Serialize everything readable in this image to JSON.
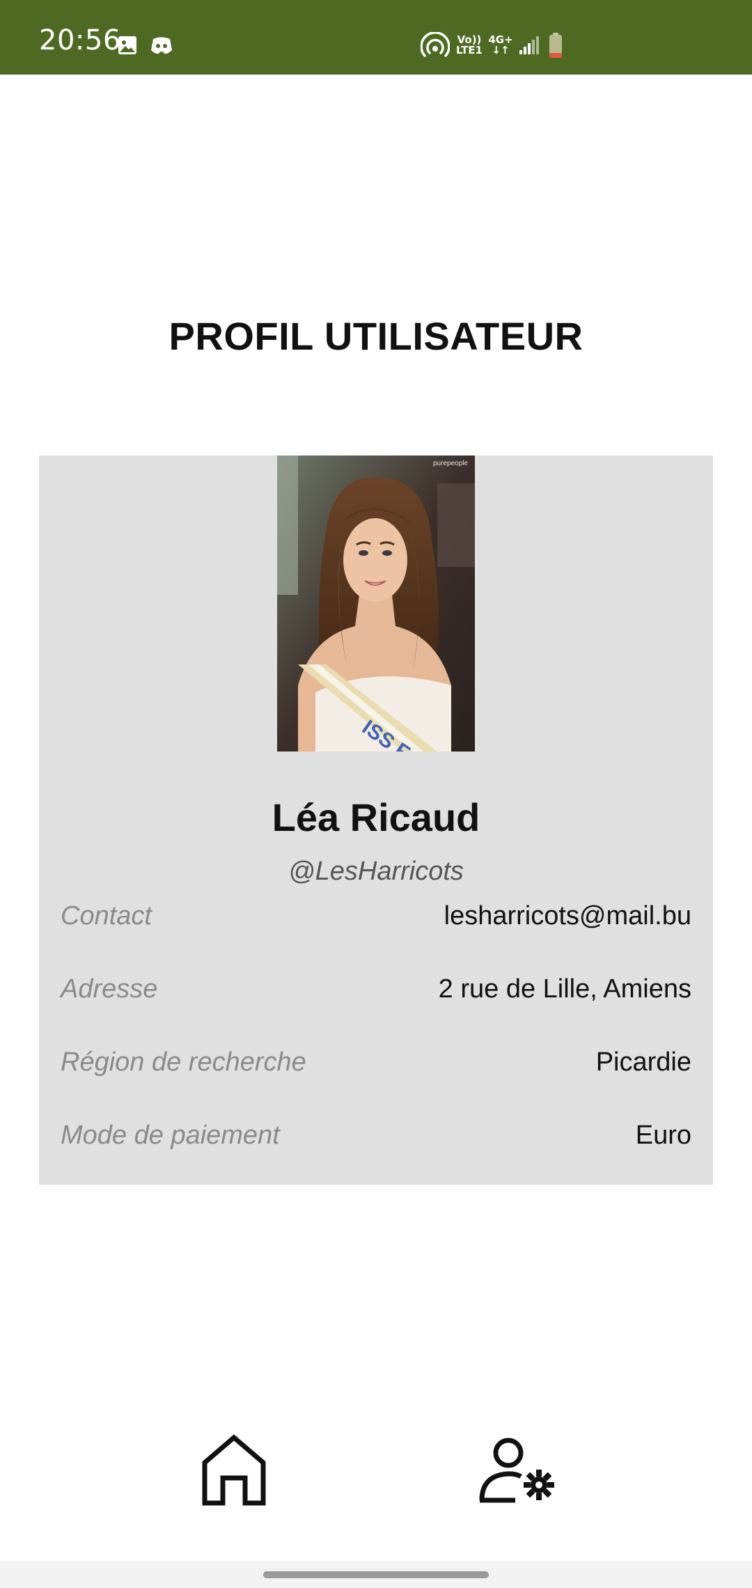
{
  "status_bar": {
    "time": "20:56",
    "background_color": "#4e6a22",
    "icons": [
      "gallery-icon",
      "discord-icon",
      "hotspot-icon",
      "volte-icon",
      "mobile-data-icon",
      "signal-icon",
      "battery-icon"
    ],
    "volte_label_top": "Vo))",
    "volte_label_bottom": "LTE1",
    "network_label": "4G+",
    "battery_level": 0.15
  },
  "page": {
    "title": "PROFIL UTILISATEUR"
  },
  "profile": {
    "name": "Léa Ricaud",
    "handle": "@LesHarricots",
    "photo_watermark": "purepeople",
    "fields": [
      {
        "label": "Contact",
        "value": "lesharricots@mail.bu"
      },
      {
        "label": "Adresse",
        "value": "2 rue de Lille, Amiens"
      },
      {
        "label": "Région de recherche",
        "value": "Picardie"
      },
      {
        "label": "Mode de paiement",
        "value": "Euro"
      }
    ]
  },
  "bottom_nav": {
    "items": [
      {
        "icon": "home-icon"
      },
      {
        "icon": "user-settings-icon"
      }
    ]
  }
}
